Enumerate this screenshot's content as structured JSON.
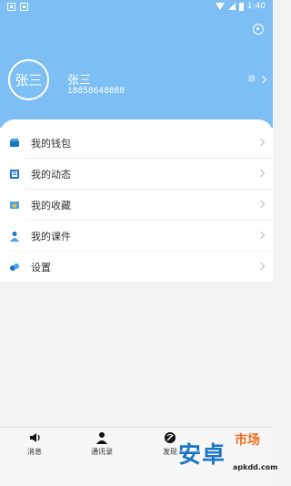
{
  "status_bar": {
    "time": "1:40"
  },
  "profile": {
    "avatar_text": "张三",
    "name": "张三",
    "phone": "18858648888",
    "profile_link_label": "跻"
  },
  "menu": [
    {
      "label": "我的钱包",
      "icon": "wallet-icon"
    },
    {
      "label": "我的动态",
      "icon": "activity-icon"
    },
    {
      "label": "我的收藏",
      "icon": "favorites-icon"
    },
    {
      "label": "我的课件",
      "icon": "courseware-icon"
    }
  ],
  "settings": {
    "label": "设置",
    "icon": "settings-icon"
  },
  "bottom_nav": [
    {
      "label": "消息",
      "icon": "speaker-icon"
    },
    {
      "label": "通讯录",
      "icon": "contacts-icon"
    },
    {
      "label": "发现",
      "icon": "discover-icon"
    }
  ],
  "watermark": {
    "main": "安卓",
    "market": "市场",
    "site": "apkdd.com"
  },
  "colors": {
    "header": "#7dbff4",
    "accent": "#1b76c4"
  }
}
